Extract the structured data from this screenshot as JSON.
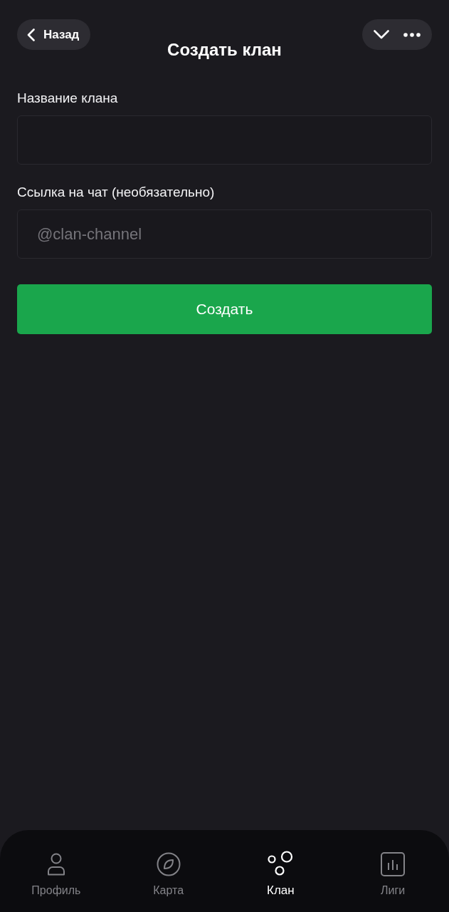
{
  "header": {
    "back_button": {
      "label": "Назад"
    },
    "title": "Создать клан"
  },
  "form": {
    "fields": [
      {
        "label": "Название клана"
      },
      {
        "label": "Ссылка на чат (необязательно)",
        "placeholder": "@clan-channel"
      }
    ],
    "submit_button": {
      "label": "Создать"
    }
  },
  "tab_bar": {
    "tabs": [
      {
        "kind": "profile",
        "label": "Профиль",
        "selected": false
      },
      {
        "kind": "map",
        "label": "Карта",
        "selected": false
      },
      {
        "kind": "clan",
        "label": "Клан",
        "selected": true
      },
      {
        "kind": "leagues",
        "label": "Лиги",
        "selected": false
      }
    ]
  }
}
